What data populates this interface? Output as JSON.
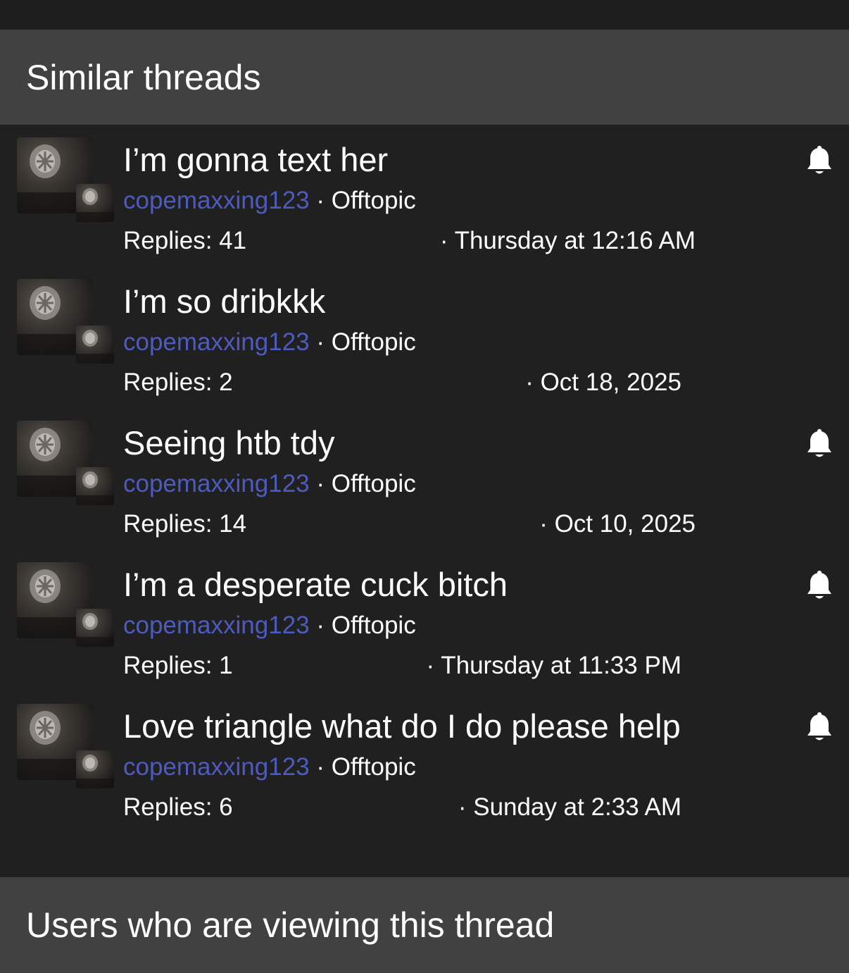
{
  "similar_threads": {
    "heading": "Similar threads",
    "threads": [
      {
        "title": "I’m gonna text her",
        "author": "copemaxxing123",
        "separator": " · ",
        "forum": "Offtopic",
        "replies": "Replies: 41",
        "date": "· Thursday at 12:16 AM",
        "watched": true
      },
      {
        "title": "I’m so dribkkk",
        "author": "copemaxxing123",
        "separator": " · ",
        "forum": "Offtopic",
        "replies": "Replies: 2",
        "date": "· Oct 18, 2025",
        "watched": false
      },
      {
        "title": "Seeing htb tdy",
        "author": "copemaxxing123",
        "separator": " · ",
        "forum": "Offtopic",
        "replies": "Replies: 14",
        "date": "· Oct 10, 2025",
        "watched": true
      },
      {
        "title": "I’m a desperate cuck bitch",
        "author": "copemaxxing123",
        "separator": " · ",
        "forum": "Offtopic",
        "replies": "Replies: 1",
        "date": "· Thursday at 11:33 PM",
        "watched": true
      },
      {
        "title": "Love triangle what do I do please help",
        "author": "copemaxxing123",
        "separator": " · ",
        "forum": "Offtopic",
        "replies": "Replies: 6",
        "date": "· Sunday at 2:33 AM",
        "watched": true
      }
    ]
  },
  "viewing_users": {
    "heading": "Users who are viewing this thread"
  },
  "colors": {
    "background": "#202021",
    "header_bar": "#414142",
    "author_link": "#4d5bbf",
    "text": "#ffffff"
  },
  "icons": {
    "watch": "bell-icon",
    "avatar": "avatar-image"
  }
}
